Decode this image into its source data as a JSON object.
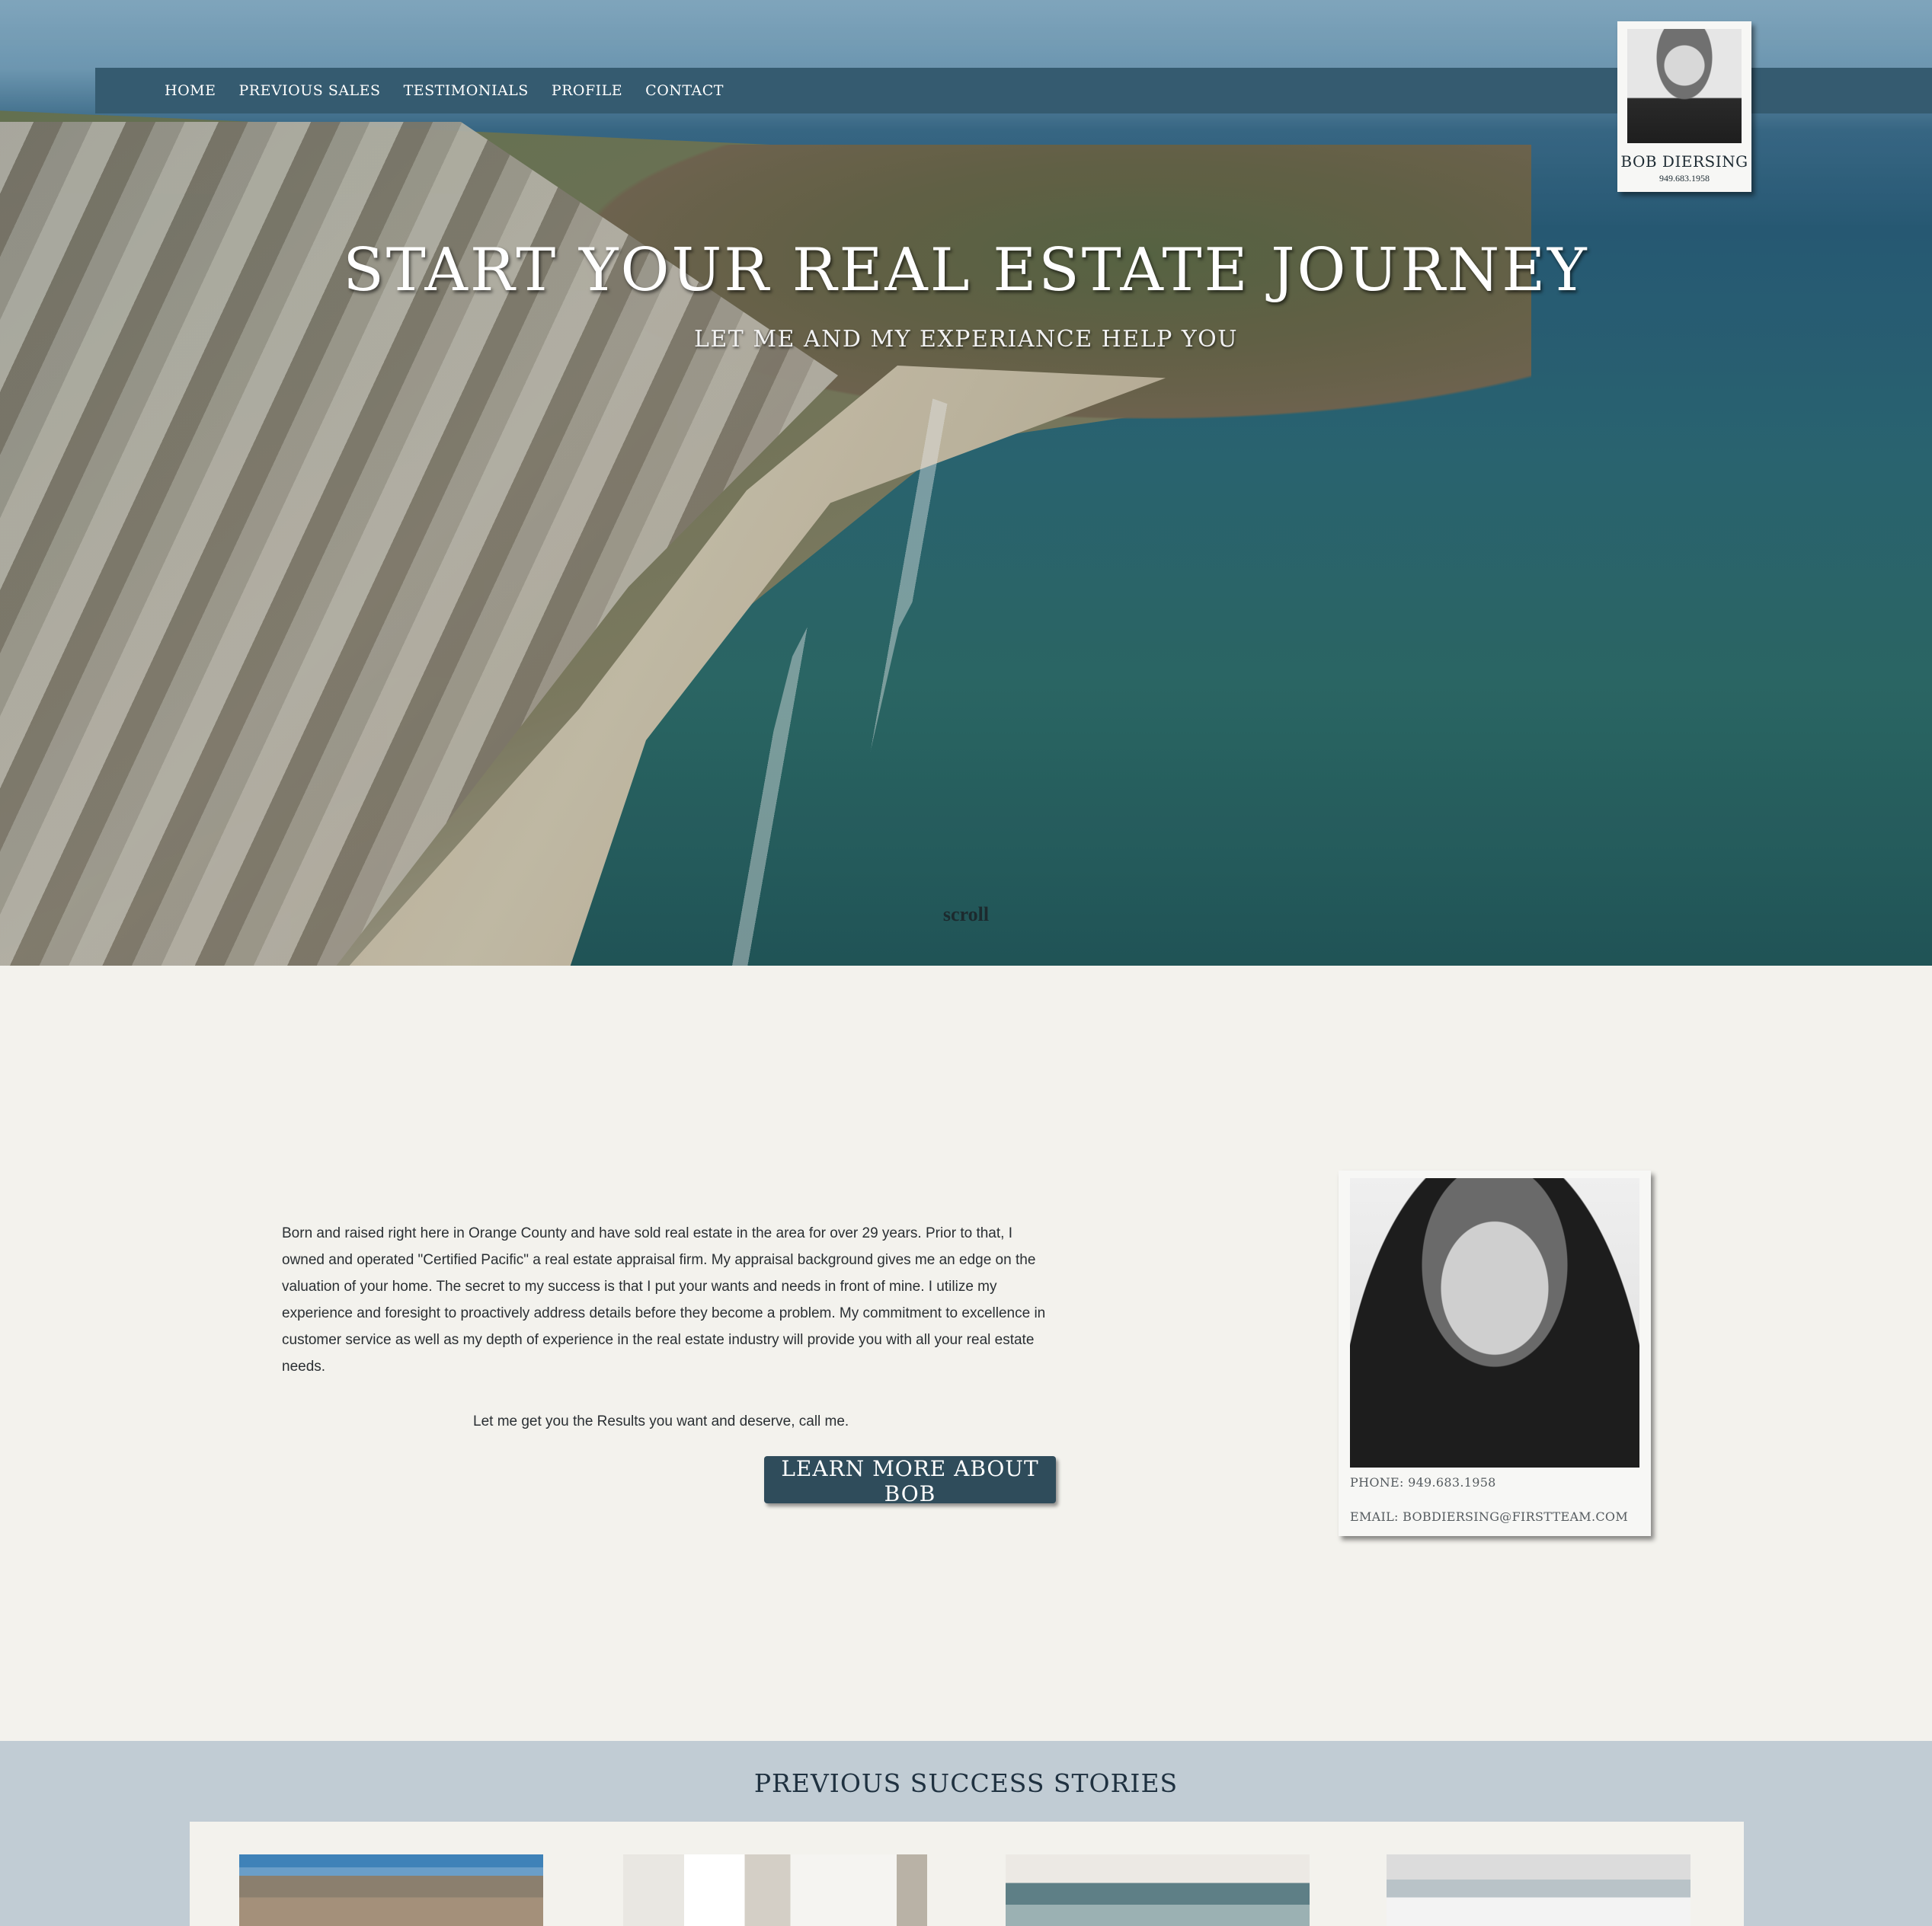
{
  "nav": {
    "items": [
      "HOME",
      "PREVIOUS SALES",
      "TESTIMONIALS",
      "PROFILE",
      "CONTACT"
    ]
  },
  "agent_card": {
    "name": "BOB DIERSING",
    "phone": "949.683.1958"
  },
  "hero": {
    "title": "START YOUR REAL ESTATE JOURNEY",
    "subtitle": "LET ME AND MY EXPERIANCE HELP YOU",
    "scroll_label": "scroll"
  },
  "about": {
    "paragraph": "Born and raised right here in Orange County and have sold real estate in the area for over 29 years. Prior to that, I owned and operated \"Certified Pacific\" a real estate appraisal firm. My appraisal background gives me an edge on the valuation of your home. The secret to my success is that I put your wants and needs in front of mine. I utilize my experience and foresight to proactively address details before they become a problem. My commitment to excellence in customer service as well as my depth of experience in the real estate industry will provide you with all your real estate needs.",
    "cta_text": "Let me get you the Results you want and deserve, call me.",
    "button_label": "LEARN MORE ABOUT BOB"
  },
  "profile_card": {
    "phone": "PHONE: 949.683.1958",
    "email": "EMAIL: BOBDIERSING@FIRSTTEAM.COM"
  },
  "success": {
    "heading": "PREVIOUS SUCCESS STORIES"
  },
  "colors": {
    "nav_bg": "#355b70",
    "button_bg": "#2f4c5b",
    "page_bg": "#f3f2ed",
    "success_bg": "#c1ccd4"
  }
}
